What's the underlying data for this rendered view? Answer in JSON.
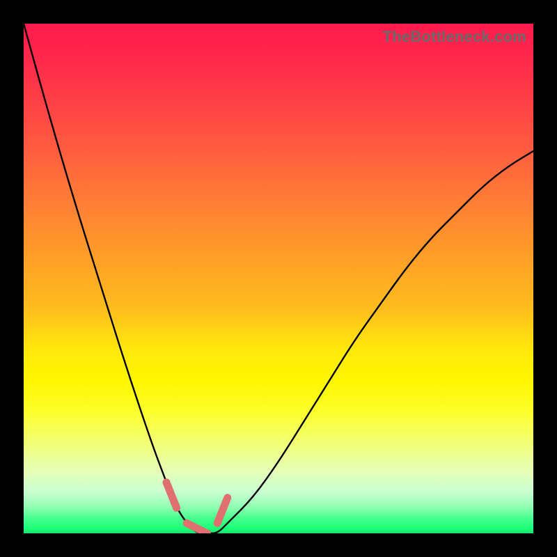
{
  "watermark": {
    "text": "TheBottleneck.com"
  },
  "chart_data": {
    "type": "line",
    "title": "",
    "xlabel": "",
    "ylabel": "",
    "xlim": [
      0,
      100
    ],
    "ylim": [
      0,
      100
    ],
    "grid": false,
    "legend": false,
    "background_gradient": {
      "top": "#ff1a4d",
      "bottom": "#19e46a"
    },
    "series": [
      {
        "name": "bottleneck-curve",
        "x": [
          0,
          5,
          10,
          15,
          20,
          25,
          28,
          30,
          32,
          34,
          36,
          38,
          40,
          45,
          50,
          55,
          60,
          65,
          70,
          75,
          80,
          85,
          90,
          95,
          100
        ],
        "y": [
          100,
          82,
          65,
          49,
          33,
          18,
          10,
          5,
          2,
          0,
          0,
          0,
          2,
          7,
          14,
          22,
          30,
          38,
          45,
          52,
          58,
          63,
          68,
          72,
          75
        ]
      }
    ],
    "markers": {
      "name": "highlighted-points",
      "color": "#e07070",
      "x": [
        28,
        29,
        30,
        32,
        34,
        36,
        38,
        39,
        40
      ],
      "y": [
        10,
        7,
        5,
        2,
        0,
        0,
        2,
        4,
        7
      ]
    }
  }
}
